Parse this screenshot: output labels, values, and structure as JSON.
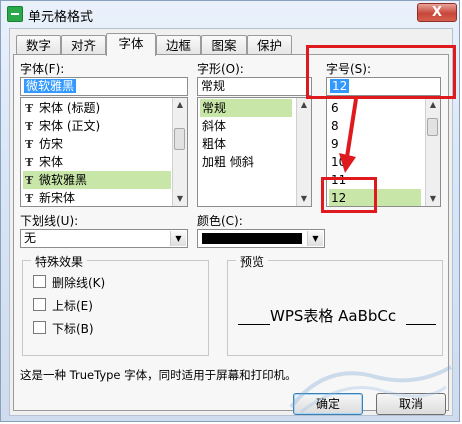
{
  "window": {
    "title": "单元格格式",
    "close_glyph": "X"
  },
  "tabs": [
    {
      "label": "数字"
    },
    {
      "label": "对齐"
    },
    {
      "label": "字体"
    },
    {
      "label": "边框"
    },
    {
      "label": "图案"
    },
    {
      "label": "保护"
    }
  ],
  "active_tab": "字体",
  "font": {
    "label": "字体(F):",
    "value": "微软雅黑",
    "items": [
      "宋体 (标题)",
      "宋体 (正文)",
      "仿宋",
      "宋体",
      "微软雅黑",
      "新宋体"
    ],
    "selected_index": 4,
    "icon": "truetype-icon"
  },
  "style": {
    "label": "字形(O):",
    "value": "常规",
    "items": [
      "常规",
      "斜体",
      "粗体",
      "加粗 倾斜"
    ],
    "selected_index": 0
  },
  "size": {
    "label": "字号(S):",
    "value": "12",
    "items": [
      "6",
      "8",
      "9",
      "10",
      "11",
      "12"
    ],
    "selected_index": 5
  },
  "underline": {
    "label": "下划线(U):",
    "value": "无"
  },
  "color": {
    "label": "颜色(C):",
    "value": "#000000"
  },
  "effects": {
    "label": "特殊效果",
    "items": [
      {
        "label": "删除线(K)",
        "checked": false
      },
      {
        "label": "上标(E)",
        "checked": false
      },
      {
        "label": "下标(B)",
        "checked": false
      }
    ]
  },
  "preview": {
    "label": "预览",
    "text": "WPS表格  AaBbCc"
  },
  "description": "这是一种 TrueType 字体，同时适用于屏幕和打印机。",
  "buttons": {
    "ok": "确定",
    "cancel": "取消"
  },
  "annotation_color": "#e0191e"
}
